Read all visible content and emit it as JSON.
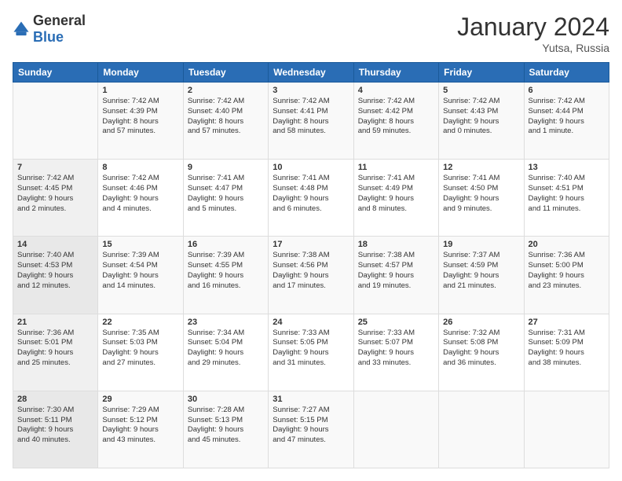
{
  "header": {
    "logo_general": "General",
    "logo_blue": "Blue",
    "month_title": "January 2024",
    "location": "Yutsa, Russia"
  },
  "days_of_week": [
    "Sunday",
    "Monday",
    "Tuesday",
    "Wednesday",
    "Thursday",
    "Friday",
    "Saturday"
  ],
  "weeks": [
    [
      {
        "day": "",
        "info": ""
      },
      {
        "day": "1",
        "info": "Sunrise: 7:42 AM\nSunset: 4:39 PM\nDaylight: 8 hours\nand 57 minutes."
      },
      {
        "day": "2",
        "info": "Sunrise: 7:42 AM\nSunset: 4:40 PM\nDaylight: 8 hours\nand 57 minutes."
      },
      {
        "day": "3",
        "info": "Sunrise: 7:42 AM\nSunset: 4:41 PM\nDaylight: 8 hours\nand 58 minutes."
      },
      {
        "day": "4",
        "info": "Sunrise: 7:42 AM\nSunset: 4:42 PM\nDaylight: 8 hours\nand 59 minutes."
      },
      {
        "day": "5",
        "info": "Sunrise: 7:42 AM\nSunset: 4:43 PM\nDaylight: 9 hours\nand 0 minutes."
      },
      {
        "day": "6",
        "info": "Sunrise: 7:42 AM\nSunset: 4:44 PM\nDaylight: 9 hours\nand 1 minute."
      }
    ],
    [
      {
        "day": "7",
        "info": "Sunrise: 7:42 AM\nSunset: 4:45 PM\nDaylight: 9 hours\nand 2 minutes."
      },
      {
        "day": "8",
        "info": "Sunrise: 7:42 AM\nSunset: 4:46 PM\nDaylight: 9 hours\nand 4 minutes."
      },
      {
        "day": "9",
        "info": "Sunrise: 7:41 AM\nSunset: 4:47 PM\nDaylight: 9 hours\nand 5 minutes."
      },
      {
        "day": "10",
        "info": "Sunrise: 7:41 AM\nSunset: 4:48 PM\nDaylight: 9 hours\nand 6 minutes."
      },
      {
        "day": "11",
        "info": "Sunrise: 7:41 AM\nSunset: 4:49 PM\nDaylight: 9 hours\nand 8 minutes."
      },
      {
        "day": "12",
        "info": "Sunrise: 7:41 AM\nSunset: 4:50 PM\nDaylight: 9 hours\nand 9 minutes."
      },
      {
        "day": "13",
        "info": "Sunrise: 7:40 AM\nSunset: 4:51 PM\nDaylight: 9 hours\nand 11 minutes."
      }
    ],
    [
      {
        "day": "14",
        "info": "Sunrise: 7:40 AM\nSunset: 4:53 PM\nDaylight: 9 hours\nand 12 minutes."
      },
      {
        "day": "15",
        "info": "Sunrise: 7:39 AM\nSunset: 4:54 PM\nDaylight: 9 hours\nand 14 minutes."
      },
      {
        "day": "16",
        "info": "Sunrise: 7:39 AM\nSunset: 4:55 PM\nDaylight: 9 hours\nand 16 minutes."
      },
      {
        "day": "17",
        "info": "Sunrise: 7:38 AM\nSunset: 4:56 PM\nDaylight: 9 hours\nand 17 minutes."
      },
      {
        "day": "18",
        "info": "Sunrise: 7:38 AM\nSunset: 4:57 PM\nDaylight: 9 hours\nand 19 minutes."
      },
      {
        "day": "19",
        "info": "Sunrise: 7:37 AM\nSunset: 4:59 PM\nDaylight: 9 hours\nand 21 minutes."
      },
      {
        "day": "20",
        "info": "Sunrise: 7:36 AM\nSunset: 5:00 PM\nDaylight: 9 hours\nand 23 minutes."
      }
    ],
    [
      {
        "day": "21",
        "info": "Sunrise: 7:36 AM\nSunset: 5:01 PM\nDaylight: 9 hours\nand 25 minutes."
      },
      {
        "day": "22",
        "info": "Sunrise: 7:35 AM\nSunset: 5:03 PM\nDaylight: 9 hours\nand 27 minutes."
      },
      {
        "day": "23",
        "info": "Sunrise: 7:34 AM\nSunset: 5:04 PM\nDaylight: 9 hours\nand 29 minutes."
      },
      {
        "day": "24",
        "info": "Sunrise: 7:33 AM\nSunset: 5:05 PM\nDaylight: 9 hours\nand 31 minutes."
      },
      {
        "day": "25",
        "info": "Sunrise: 7:33 AM\nSunset: 5:07 PM\nDaylight: 9 hours\nand 33 minutes."
      },
      {
        "day": "26",
        "info": "Sunrise: 7:32 AM\nSunset: 5:08 PM\nDaylight: 9 hours\nand 36 minutes."
      },
      {
        "day": "27",
        "info": "Sunrise: 7:31 AM\nSunset: 5:09 PM\nDaylight: 9 hours\nand 38 minutes."
      }
    ],
    [
      {
        "day": "28",
        "info": "Sunrise: 7:30 AM\nSunset: 5:11 PM\nDaylight: 9 hours\nand 40 minutes."
      },
      {
        "day": "29",
        "info": "Sunrise: 7:29 AM\nSunset: 5:12 PM\nDaylight: 9 hours\nand 43 minutes."
      },
      {
        "day": "30",
        "info": "Sunrise: 7:28 AM\nSunset: 5:13 PM\nDaylight: 9 hours\nand 45 minutes."
      },
      {
        "day": "31",
        "info": "Sunrise: 7:27 AM\nSunset: 5:15 PM\nDaylight: 9 hours\nand 47 minutes."
      },
      {
        "day": "",
        "info": ""
      },
      {
        "day": "",
        "info": ""
      },
      {
        "day": "",
        "info": ""
      }
    ]
  ]
}
